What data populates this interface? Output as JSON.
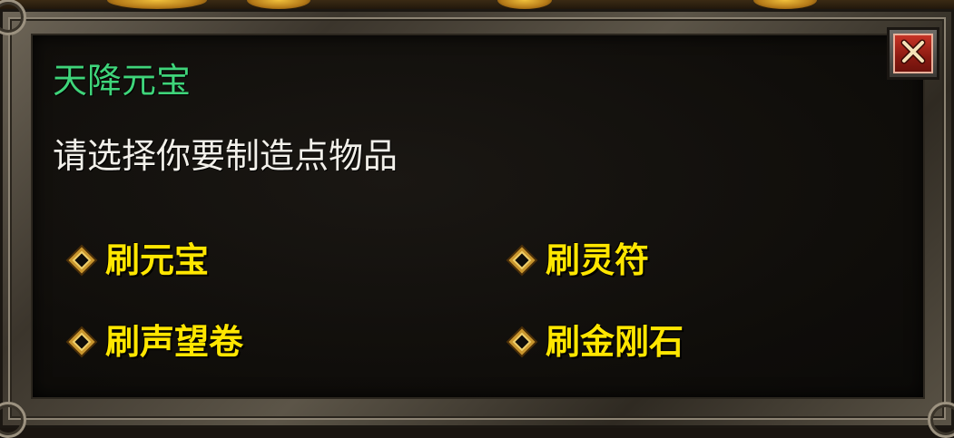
{
  "dialog": {
    "title": "天降元宝",
    "prompt": "请选择你要制造点物品",
    "options": [
      {
        "label": "刷元宝"
      },
      {
        "label": "刷灵符"
      },
      {
        "label": "刷声望卷"
      },
      {
        "label": "刷金刚石"
      }
    ],
    "close_icon": "close-icon"
  },
  "colors": {
    "title": "#3fd47a",
    "prompt": "#f2f0ea",
    "option": "#ffe600",
    "close_button": "#c63426"
  }
}
